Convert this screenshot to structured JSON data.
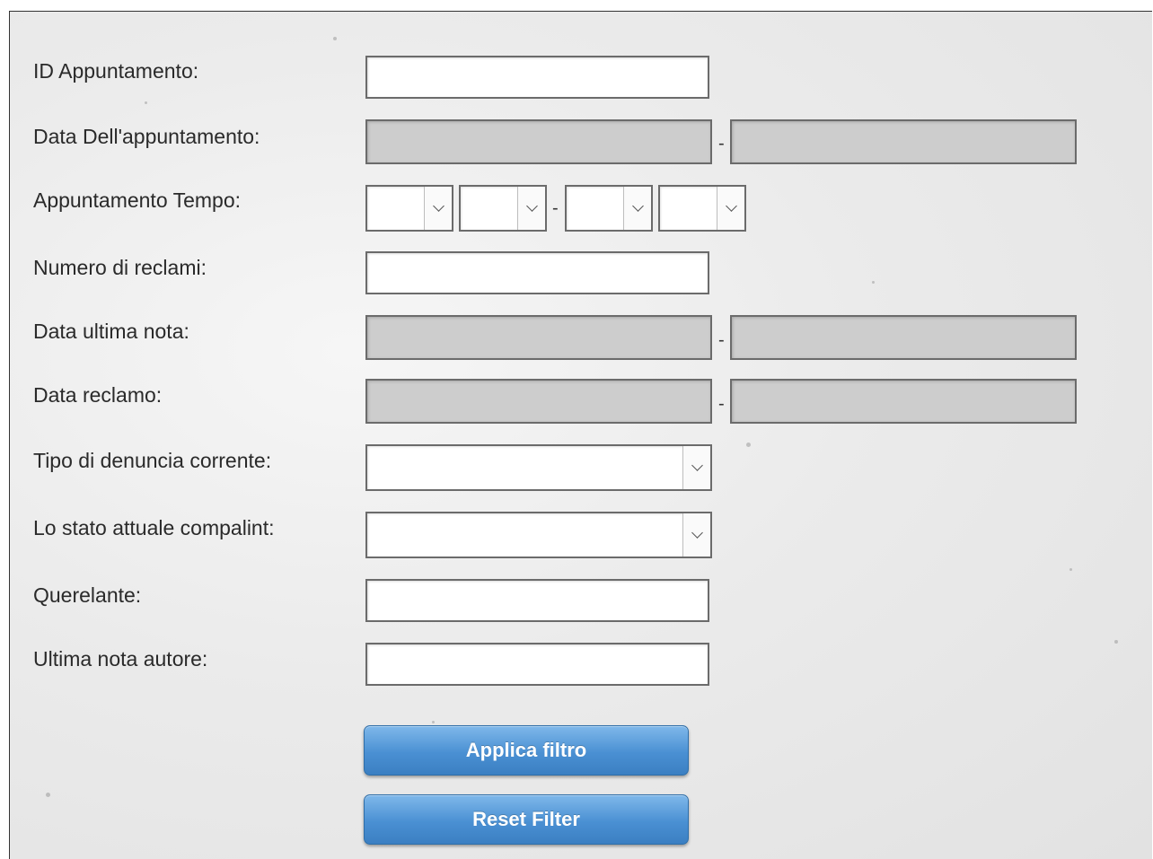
{
  "fields": {
    "id_appuntamento": {
      "label": "ID Appuntamento:",
      "value": ""
    },
    "data_appuntamento": {
      "label": "Data Dell'appuntamento:",
      "from": "",
      "to": "",
      "separator": "-"
    },
    "appuntamento_tempo": {
      "label": "Appuntamento Tempo:",
      "separator": "-"
    },
    "numero_reclami": {
      "label": "Numero di reclami:",
      "value": ""
    },
    "data_ultima_nota": {
      "label": "Data ultima nota:",
      "separator": "-"
    },
    "data_reclamo": {
      "label": "Data reclamo:",
      "separator": "-"
    },
    "tipo_denuncia": {
      "label": "Tipo di denuncia corrente:",
      "selected": ""
    },
    "stato_attuale": {
      "label": "Lo stato attuale compalint:",
      "selected": ""
    },
    "querelante": {
      "label": "Querelante:",
      "value": ""
    },
    "ultima_nota_autore": {
      "label": "Ultima nota autore:",
      "value": ""
    }
  },
  "buttons": {
    "apply": "Applica filtro",
    "reset": "Reset Filter"
  },
  "icons": {
    "dropdown": "chevron-down-icon"
  },
  "colors": {
    "button": "#4a90d3",
    "date_field": "#cdcdcd",
    "background": "#ebebeb"
  }
}
